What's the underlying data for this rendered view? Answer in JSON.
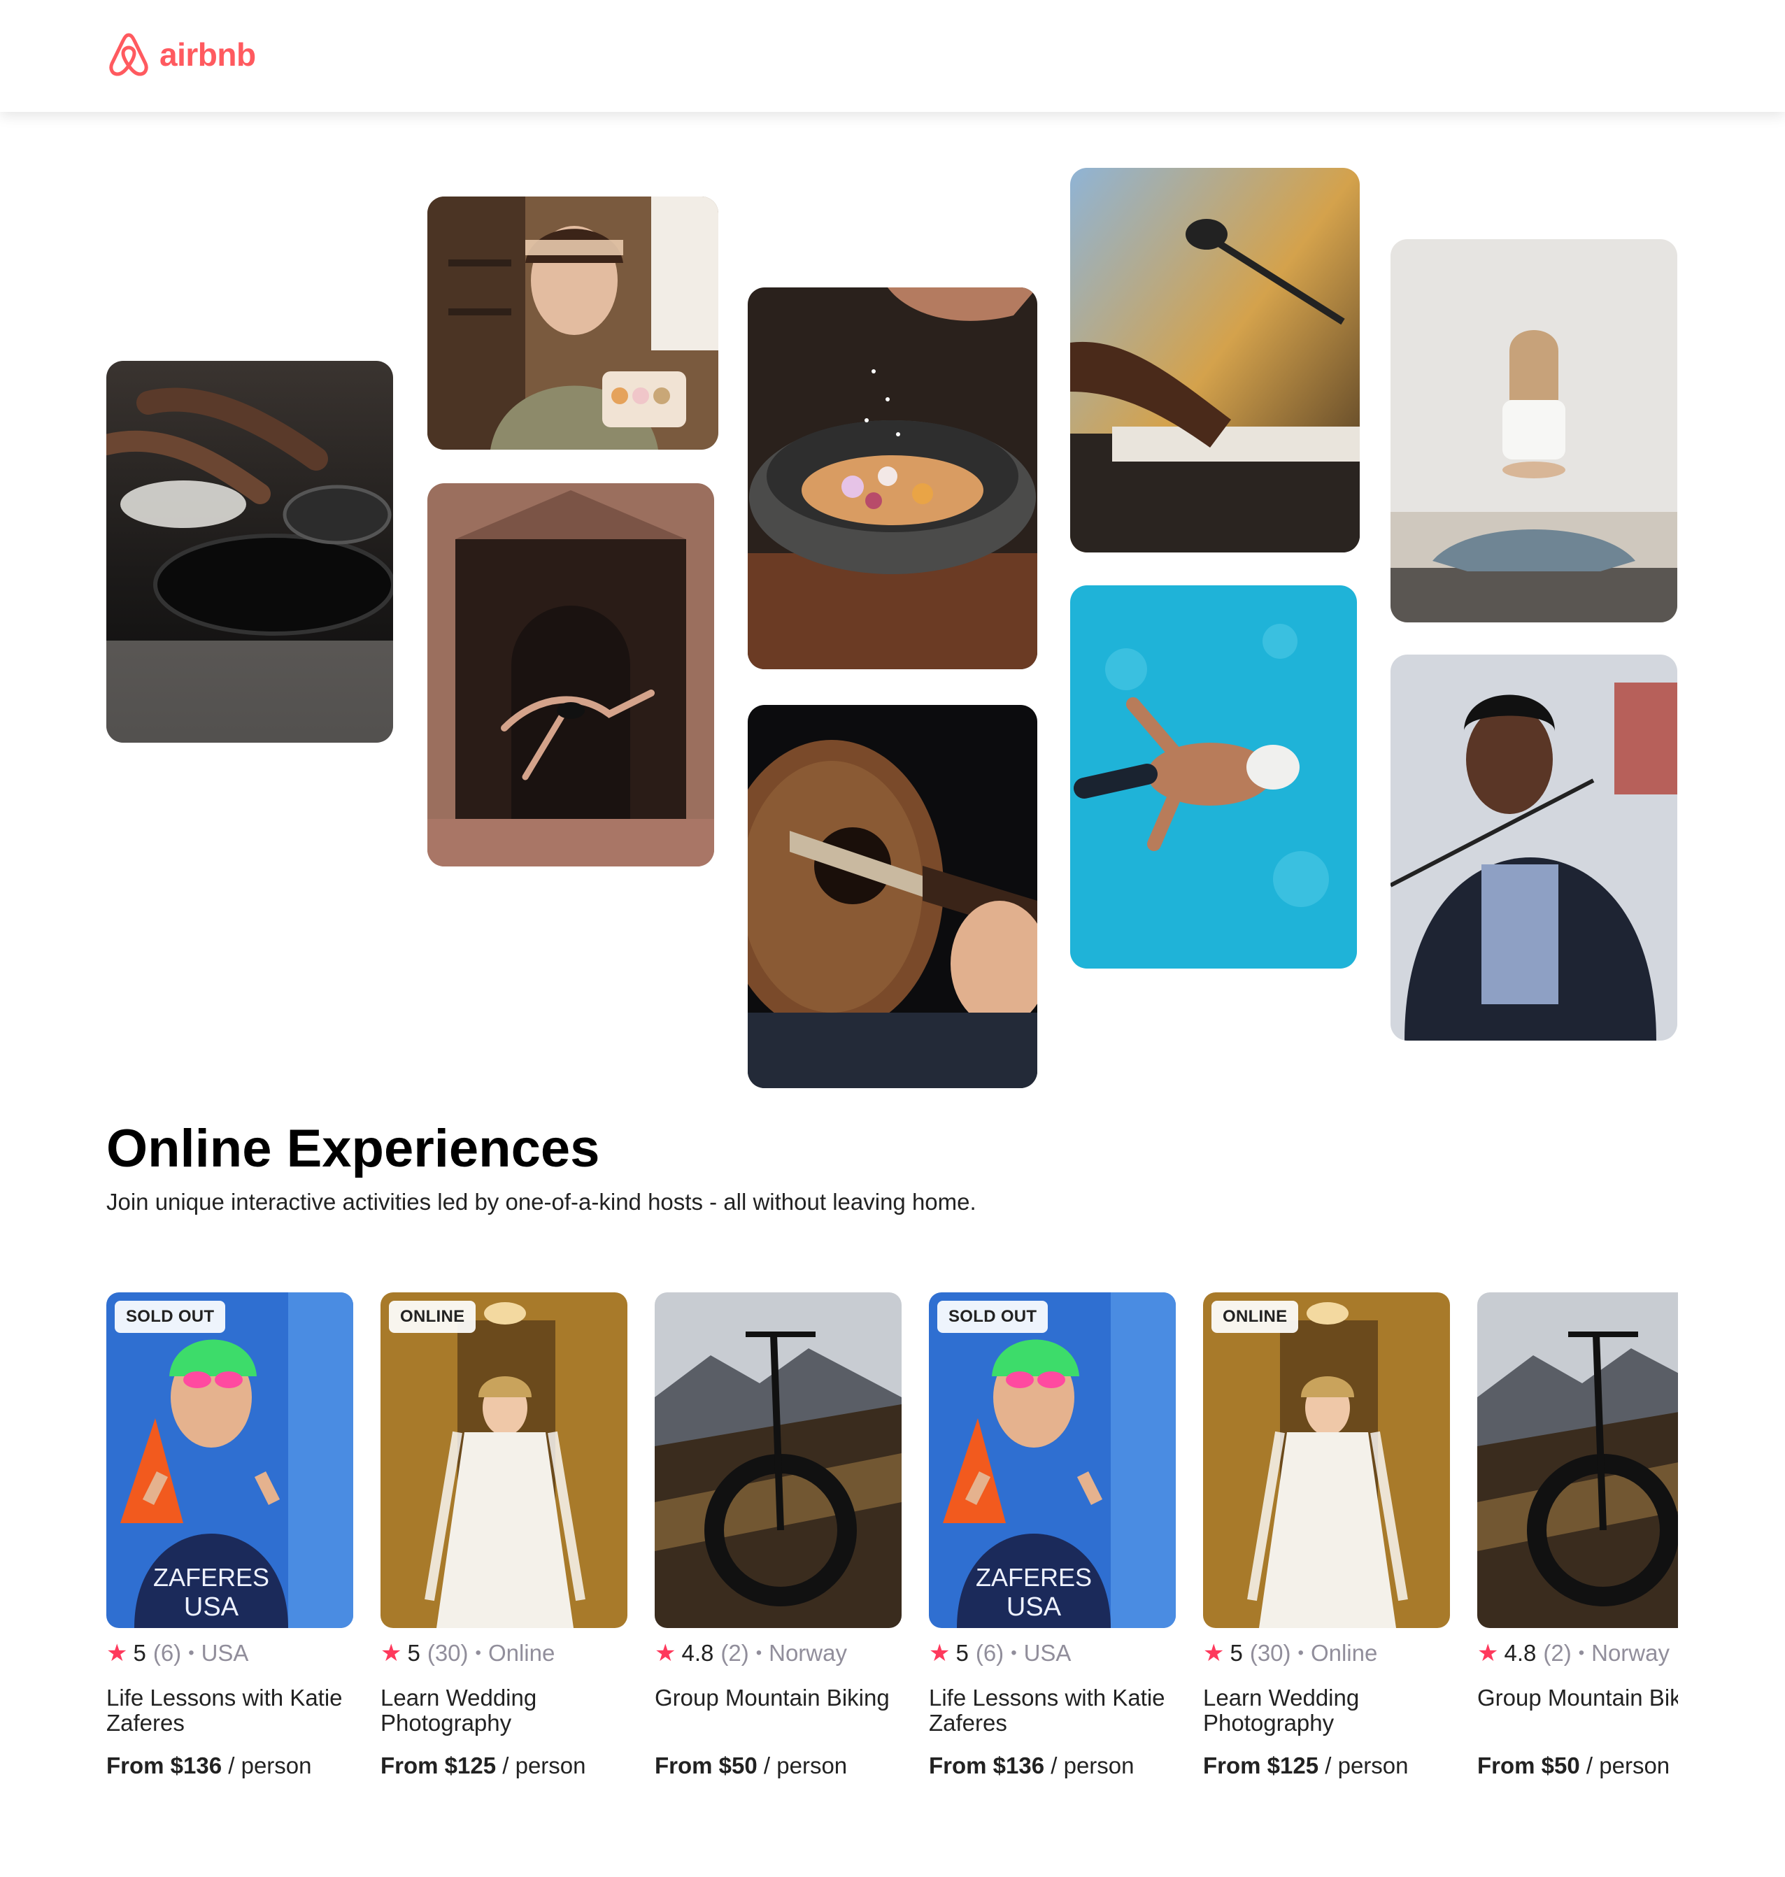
{
  "brand": {
    "name": "airbnb",
    "color": "#FF5A5F"
  },
  "hero_photos": [
    {
      "subject": "hands cooking in kitchen pans",
      "icon": "cooking-photo"
    },
    {
      "subject": "woman holding macarons",
      "icon": "baker-photo"
    },
    {
      "subject": "dancer leaping in stone doorway",
      "icon": "dancer-photo"
    },
    {
      "subject": "seasoning a stone bowl",
      "icon": "bowl-photo"
    },
    {
      "subject": "acoustic guitar being played",
      "icon": "guitar-photo"
    },
    {
      "subject": "hands on keyboard with microphone",
      "icon": "keyboard-photo"
    },
    {
      "subject": "swimmer in blue pool",
      "icon": "swimmer-photo"
    },
    {
      "subject": "woman meditating",
      "icon": "yoga-photo"
    },
    {
      "subject": "singer at microphone",
      "icon": "singer-photo"
    }
  ],
  "section": {
    "title": "Online Experiences",
    "subtitle": "Join unique interactive activities led by one-of-a-kind hosts - all without leaving home."
  },
  "cards": [
    {
      "badge": "SOLD OUT",
      "rating": "5",
      "reviews": "(6)",
      "location": "USA",
      "title": "Life Lessons with Katie Zaferes",
      "price": "From $136",
      "unit": "/ person",
      "photo": "athlete-photo"
    },
    {
      "badge": "ONLINE",
      "rating": "5",
      "reviews": "(30)",
      "location": "Online",
      "title": "Learn Wedding Photography",
      "price": "From $125",
      "unit": "/ person",
      "photo": "bride-photo"
    },
    {
      "badge": "",
      "rating": "4.8",
      "reviews": "(2)",
      "location": "Norway",
      "title": "Group Mountain Biking",
      "price": "From $50",
      "unit": "/ person",
      "photo": "bike-photo"
    },
    {
      "badge": "SOLD OUT",
      "rating": "5",
      "reviews": "(6)",
      "location": "USA",
      "title": "Life Lessons with Katie Zaferes",
      "price": "From $136",
      "unit": "/ person",
      "photo": "athlete-photo"
    },
    {
      "badge": "ONLINE",
      "rating": "5",
      "reviews": "(30)",
      "location": "Online",
      "title": "Learn Wedding Photography",
      "price": "From $125",
      "unit": "/ person",
      "photo": "bride-photo"
    },
    {
      "badge": "",
      "rating": "4.8",
      "reviews": "(2)",
      "location": "Norway",
      "title": "Group Mountain Biking",
      "price": "From $50",
      "unit": "/ person",
      "photo": "bike-photo"
    }
  ],
  "colors": {
    "star": "#FE395C",
    "muted": "#918E9B",
    "text": "#222222"
  }
}
